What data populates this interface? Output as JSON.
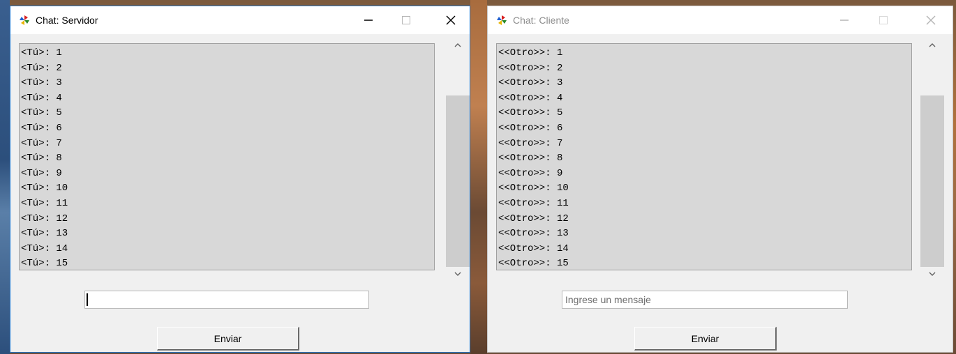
{
  "server": {
    "title": "Chat: Servidor",
    "messages": [
      "<Tú>: 1",
      "<Tú>: 2",
      "<Tú>: 3",
      "<Tú>: 4",
      "<Tú>: 5",
      "<Tú>: 6",
      "<Tú>: 7",
      "<Tú>: 8",
      "<Tú>: 9",
      "<Tú>: 10",
      "<Tú>: 11",
      "<Tú>: 12",
      "<Tú>: 13",
      "<Tú>: 14",
      "<Tú>: 15"
    ],
    "input_value": "",
    "send_label": "Enviar"
  },
  "client": {
    "title": "Chat: Cliente",
    "messages": [
      "<<Otro>>: 1",
      "<<Otro>>: 2",
      "<<Otro>>: 3",
      "<<Otro>>: 4",
      "<<Otro>>: 5",
      "<<Otro>>: 6",
      "<<Otro>>: 7",
      "<<Otro>>: 8",
      "<<Otro>>: 9",
      "<<Otro>>: 10",
      "<<Otro>>: 11",
      "<<Otro>>: 12",
      "<<Otro>>: 13",
      "<<Otro>>: 14",
      "<<Otro>>: 15"
    ],
    "input_placeholder": "Ingrese un mensaje",
    "send_label": "Enviar"
  },
  "icons": {
    "app": "pinwheel-icon",
    "minimize": "minimize-icon",
    "maximize": "maximize-icon",
    "close": "close-icon",
    "scroll_up": "chevron-up-icon",
    "scroll_down": "chevron-down-icon"
  },
  "colors": {
    "active_border": "#1f79d2",
    "chat_background": "#d8d8d8",
    "inactive_title": "#8e8e8e"
  }
}
